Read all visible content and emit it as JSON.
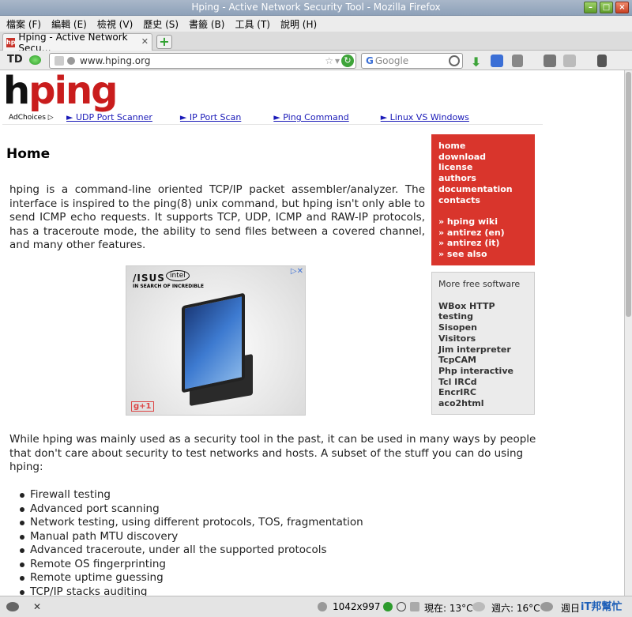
{
  "window": {
    "title": "Hping - Active Network Security Tool - Mozilla Firefox"
  },
  "menu": [
    "檔案 (F)",
    "編輯 (E)",
    "檢視 (V)",
    "歷史 (S)",
    "書籤 (B)",
    "工具 (T)",
    "說明 (H)"
  ],
  "tab": {
    "label": "Hping - Active Network Secu…",
    "favicon_label": "hp"
  },
  "nav": {
    "td_label": "TD",
    "url": "www.hping.org",
    "search_placeholder": "Google",
    "search_engine_label": "G"
  },
  "page": {
    "logo_dark": "h",
    "logo_red": "ping",
    "adchoices": "AdChoices ▷",
    "top_links": [
      "► UDP Port Scanner",
      "► IP Port Scan",
      "► Ping Command",
      "► Linux VS Windows"
    ],
    "heading": "Home",
    "intro": "hping is a command-line oriented TCP/IP packet assembler/analyzer. The interface is inspired to the ping(8) unix command, but hping isn't only able to send ICMP echo requests. It supports TCP, UDP, ICMP and RAW-IP protocols, has a traceroute mode, the ability to send files between a covered channel, and many other features.",
    "ad": {
      "brand": "/ISUS",
      "intel": "intel",
      "slogan": "IN SEARCH OF INCREDIBLE",
      "gplus": "g+1"
    },
    "body2": "While hping was mainly used as a security tool in the past, it can be used in many ways by people that don't care about security to test networks and hosts. A subset of the stuff you can do using hping:",
    "features": [
      "Firewall testing",
      "Advanced port scanning",
      "Network testing, using different protocols, TOS, fragmentation",
      "Manual path MTU discovery",
      "Advanced traceroute, under all the supported protocols",
      "Remote OS fingerprinting",
      "Remote uptime guessing",
      "TCP/IP stacks auditing"
    ],
    "nav_box": [
      "home",
      "download",
      "license",
      "authors",
      "documentation",
      "contacts"
    ],
    "nav_box_extra": [
      "» hping wiki",
      "» antirez (en)",
      "» antirez (it)",
      "» see also"
    ],
    "free_title": "More free software",
    "free_items": [
      "WBox HTTP",
      "testing",
      "Sisopen",
      "Visitors",
      "Jim interpreter",
      "TcpCAM",
      "Php interactive",
      "Tcl IRCd",
      "EncrIRC",
      "aco2html"
    ]
  },
  "status": {
    "resolution": "1042x997",
    "weather_now": "現在: 13°C",
    "weather_sat": "週六: 16°C",
    "weather_day": "週日",
    "brand": "iT邦幫忙"
  },
  "colors": {
    "accent_red": "#d9352c",
    "link_blue": "#1a1ab8"
  }
}
